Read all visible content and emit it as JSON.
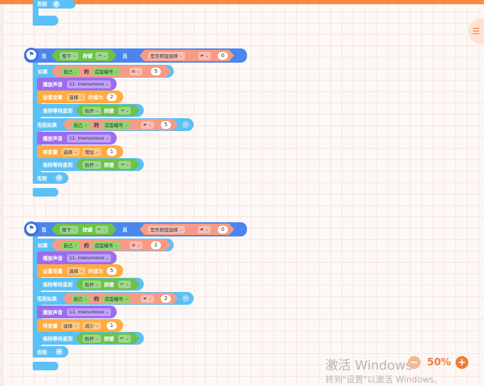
{
  "colors": {
    "accent": "#ff8a3d",
    "event": "#4a86ee",
    "control": "#5bc0f5",
    "sensing": "#6cc24a",
    "operator": "#f79b86",
    "variable": "#ffab40",
    "sound": "#9c6cf0"
  },
  "top_fragment": {
    "else_label": "否则"
  },
  "groups": [
    {
      "hat": {
        "when": "当",
        "press": "按下",
        "key_label": "按键",
        "key": "→",
        "and": "且",
        "sensing": "是否按钮选择",
        "op": "≠",
        "value": "0"
      },
      "if": {
        "label": "如果",
        "self": "自己",
        "of": "的",
        "prop": "造型编号",
        "op": "≥",
        "value": "5"
      },
      "play1": {
        "label": "播放声音",
        "sound": "11. menumove"
      },
      "setvar": {
        "label": "设置变量",
        "var": "选择",
        "to": "的值为",
        "value": "2"
      },
      "wait1": {
        "label": "保持等待直到",
        "release": "抬开",
        "key_label": "按键",
        "key": "→"
      },
      "elseif": {
        "label": "否则如果",
        "self": "自己",
        "of": "的",
        "prop": "造型编号",
        "op": "≠",
        "value": "5"
      },
      "play2": {
        "label": "播放声音",
        "sound": "11. menumove"
      },
      "changevar": {
        "label": "将变量",
        "var": "选择",
        "dir": "增加",
        "value": "1"
      },
      "wait2": {
        "label": "保持等待直到",
        "release": "抬开",
        "key_label": "按键",
        "key": "→"
      },
      "else": {
        "label": "否则"
      }
    },
    {
      "hat": {
        "when": "当",
        "press": "按下",
        "key_label": "按键",
        "key": "←",
        "and": "且",
        "sensing": "是否按钮选择",
        "op": "≠",
        "value": "0"
      },
      "if": {
        "label": "如果",
        "self": "自己",
        "of": "的",
        "prop": "造型编号",
        "op": "≤",
        "value": "2"
      },
      "play1": {
        "label": "播放声音",
        "sound": "11. menumove"
      },
      "setvar": {
        "label": "设置变量",
        "var": "选择",
        "to": "的值为",
        "value": "5"
      },
      "wait1": {
        "label": "保持等待直到",
        "release": "抬开",
        "key_label": "按键",
        "key": "←"
      },
      "elseif": {
        "label": "否则如果",
        "self": "自己",
        "of": "的",
        "prop": "造型编号",
        "op": "≠",
        "value": "2"
      },
      "play2": {
        "label": "播放声音",
        "sound": "11. menumove"
      },
      "changevar": {
        "label": "将变量",
        "var": "选择",
        "dir": "减少",
        "value": "1"
      },
      "wait2": {
        "label": "保持等待直到",
        "release": "抬开",
        "key_label": "按键",
        "key": "←"
      },
      "else": {
        "label": "否则"
      }
    }
  ],
  "zoom": {
    "value": "50%",
    "minus": "−",
    "plus": "+"
  },
  "watermark": {
    "line1": "激活 Windows",
    "line2": "转到\"设置\"以激活 Windows。"
  },
  "icons": {
    "corner": "menu-icon",
    "flag": "flag-icon"
  }
}
